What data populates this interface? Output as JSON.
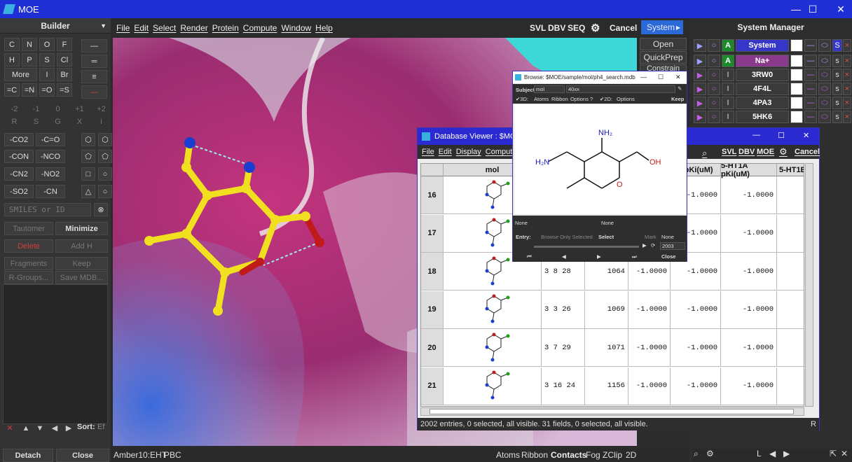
{
  "app": {
    "title": "MOE"
  },
  "builder": {
    "title": "Builder",
    "elements": [
      "C",
      "N",
      "O",
      "F",
      "H",
      "P",
      "S",
      "Cl",
      "More",
      "I",
      "Br"
    ],
    "charges": [
      "=C",
      "=N",
      "=O",
      "=S"
    ],
    "formal": [
      "-2",
      "-1",
      "0",
      "+1",
      "+2",
      "R",
      "S",
      "G",
      "X",
      "i"
    ],
    "groups": [
      "-CO2",
      "-C=O",
      "-CON",
      "-NCO",
      "-CN2",
      "-NO2",
      "-SO2",
      "-CN"
    ],
    "smiles_placeholder": "SMILES or ID",
    "buttons": {
      "tautomer": "Tautomer",
      "minimize": "Minimize",
      "delete": "Delete",
      "addh": "Add H",
      "fragments": "Fragments",
      "keep": "Keep",
      "rgroups": "R-Groups...",
      "savemdb": "Save MDB..."
    },
    "sort_label": "Sort:",
    "sort_value": "Ef",
    "detach": "Detach",
    "close": "Close"
  },
  "menu": [
    "File",
    "Edit",
    "Select",
    "Render",
    "Protein",
    "Compute",
    "Window",
    "Help"
  ],
  "toolbar": {
    "svl": "SVL",
    "dbv": "DBV",
    "seq": "SEQ",
    "cancel": "Cancel",
    "system": "System"
  },
  "right_buttons": {
    "open": "Open",
    "quickprep": "QuickPrep",
    "constrain": "Constrain"
  },
  "system_manager": {
    "title": "System Manager",
    "rows": [
      {
        "flag": "A",
        "name": "System"
      },
      {
        "flag": "A",
        "name": "Na+"
      },
      {
        "flag": "I",
        "name": "3RW0"
      },
      {
        "flag": "I",
        "name": "4F4L"
      },
      {
        "flag": "I",
        "name": "4PA3"
      },
      {
        "flag": "I",
        "name": "5HK6"
      }
    ],
    "s_label": "S",
    "s2": "s",
    "x": "×"
  },
  "dbv": {
    "title": "Database Viewer : $MOE/sa",
    "menu": [
      "File",
      "Edit",
      "Display",
      "Compute"
    ],
    "tools": {
      "svl": "SVL",
      "dbv": "DBV",
      "moe": "MOE",
      "cancel": "Cancel"
    },
    "columns": [
      "mol",
      "1 pKi(uM)",
      "5-HT1A pKi(uM)",
      "5-HT1B p"
    ],
    "rows": [
      {
        "id": "16",
        "a": "",
        "b": "",
        "v1": "-1.0000",
        "v2": "-1.0000"
      },
      {
        "id": "17",
        "a": "",
        "b": "",
        "v1": "-1.0000",
        "v2": "-1.0000"
      },
      {
        "id": "18",
        "a": "3 8 28",
        "b": "1064",
        "v0": "-1.0000",
        "v1": "-1.0000",
        "v2": "-1.0000"
      },
      {
        "id": "19",
        "a": "3 3 26",
        "b": "1069",
        "v0": "-1.0000",
        "v1": "-1.0000",
        "v2": "-1.0000"
      },
      {
        "id": "20",
        "a": "3 7 29",
        "b": "1071",
        "v0": "-1.0000",
        "v1": "-1.0000",
        "v2": "-1.0000"
      },
      {
        "id": "21",
        "a": "3 16 24",
        "b": "1156",
        "v0": "-1.0000",
        "v1": "-1.0000",
        "v2": "-1.0000"
      }
    ],
    "status": "2002 entries, 0 selected, all visible. 31 fields, 0 selected, all visible.",
    "r_label": "R"
  },
  "browse": {
    "title": "Browse: $MOE/sample/mol/ph4_search.mdb",
    "subject_label": "Subject:",
    "subject_value": "mol",
    "subject_field": "40xx",
    "opts": {
      "d3": "3D:",
      "atoms": "Atoms",
      "ribbon": "Ribbon",
      "options": "Options",
      "q": "?",
      "d2": "2D:",
      "options2": "Options",
      "keep": "Keep"
    },
    "mol_labels": {
      "nh2": "NH₂",
      "h2n": "H₂N",
      "oh": "OH",
      "o": "O"
    },
    "none1": "None",
    "none2": "None",
    "none3": "None",
    "entry_label": "Entry:",
    "browse_only": "Browse Only Selected",
    "select": "Select",
    "mark": "Mark",
    "count": "2003",
    "close": "Close"
  },
  "statusbar": {
    "ff": "Amber10:EHT",
    "pbc": "PBC",
    "atoms": "Atoms",
    "ribbon": "Ribbon",
    "contacts": "Contacts",
    "fog": "Fog",
    "zclip": "ZClip",
    "d2": "2D",
    "l": "L"
  },
  "colors": {
    "accent": "#1f2fd6",
    "carbon": "#f0e020",
    "nitrogen": "#1a3fd0",
    "oxygen": "#c01a1a"
  }
}
